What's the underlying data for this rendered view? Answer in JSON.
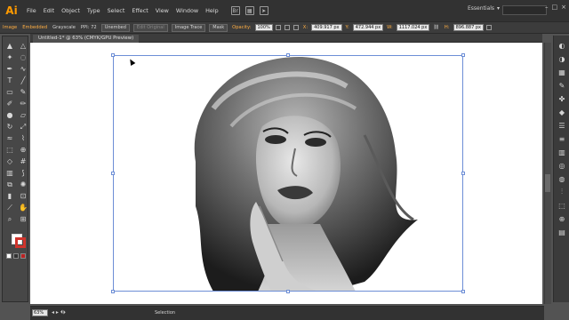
{
  "app": {
    "logo_text": "Ai",
    "menu": [
      "File",
      "Edit",
      "Object",
      "Type",
      "Select",
      "Effect",
      "View",
      "Window",
      "Help"
    ],
    "workspace": "Essentials"
  },
  "control_bar": {
    "label_image": "Image",
    "embedded": "Embedded",
    "grayscale": "Grayscale",
    "ppi": "PPI: 72",
    "unembed": "Unembed",
    "edit_original": "Edit Original",
    "image_trace": "Image Trace",
    "mask": "Mask",
    "opacity_label": "Opacity:",
    "opacity_value": "100%",
    "x_label": "X:",
    "x_value": "409.917 px",
    "y_label": "Y:",
    "y_value": "472.944 px",
    "w_label": "W:",
    "w_value": "1117.024 px",
    "h_label": "H:",
    "h_value": "896.887 px"
  },
  "document": {
    "tab_title": "Untitled-1* @ 63% (CMYK/GPU Preview)",
    "zoom": "63%",
    "status": "Selection"
  },
  "tools": {
    "icons": [
      "selection-arrow-icon",
      "direct-selection-icon",
      "magic-wand-icon",
      "lasso-icon",
      "pen-icon",
      "curvature-icon",
      "type-icon",
      "line-icon",
      "rectangle-icon",
      "paintbrush-icon",
      "shaper-icon",
      "pencil-icon",
      "blob-brush-icon",
      "eraser-icon",
      "rotate-icon",
      "scale-icon",
      "width-icon",
      "warp-icon",
      "free-transform-icon",
      "shape-builder-icon",
      "perspective-icon",
      "mesh-icon",
      "gradient-icon",
      "eyedropper-icon",
      "blend-icon",
      "symbol-sprayer-icon",
      "column-graph-icon",
      "artboard-icon",
      "slice-icon",
      "hand-icon",
      "zoom-icon",
      "print-tiling-icon"
    ]
  },
  "dock": {
    "icons": [
      "color-icon",
      "color-guide-icon",
      "swatches-icon",
      "brushes-icon",
      "symbols-icon",
      "graphic-styles-icon",
      "layers-icon",
      "stroke-icon",
      "gradient-icon",
      "transparency-icon",
      "appearance-icon",
      "align-icon",
      "transform-icon",
      "pathfinder-icon",
      "libraries-icon"
    ]
  },
  "colors": {
    "ui_dark": "#323232",
    "ui_mid": "#3c3c3c",
    "canvas": "#535353",
    "accent_orange": "#ff9a00",
    "selection_blue": "#6d8ed6",
    "stroke_red": "#d0342c"
  }
}
